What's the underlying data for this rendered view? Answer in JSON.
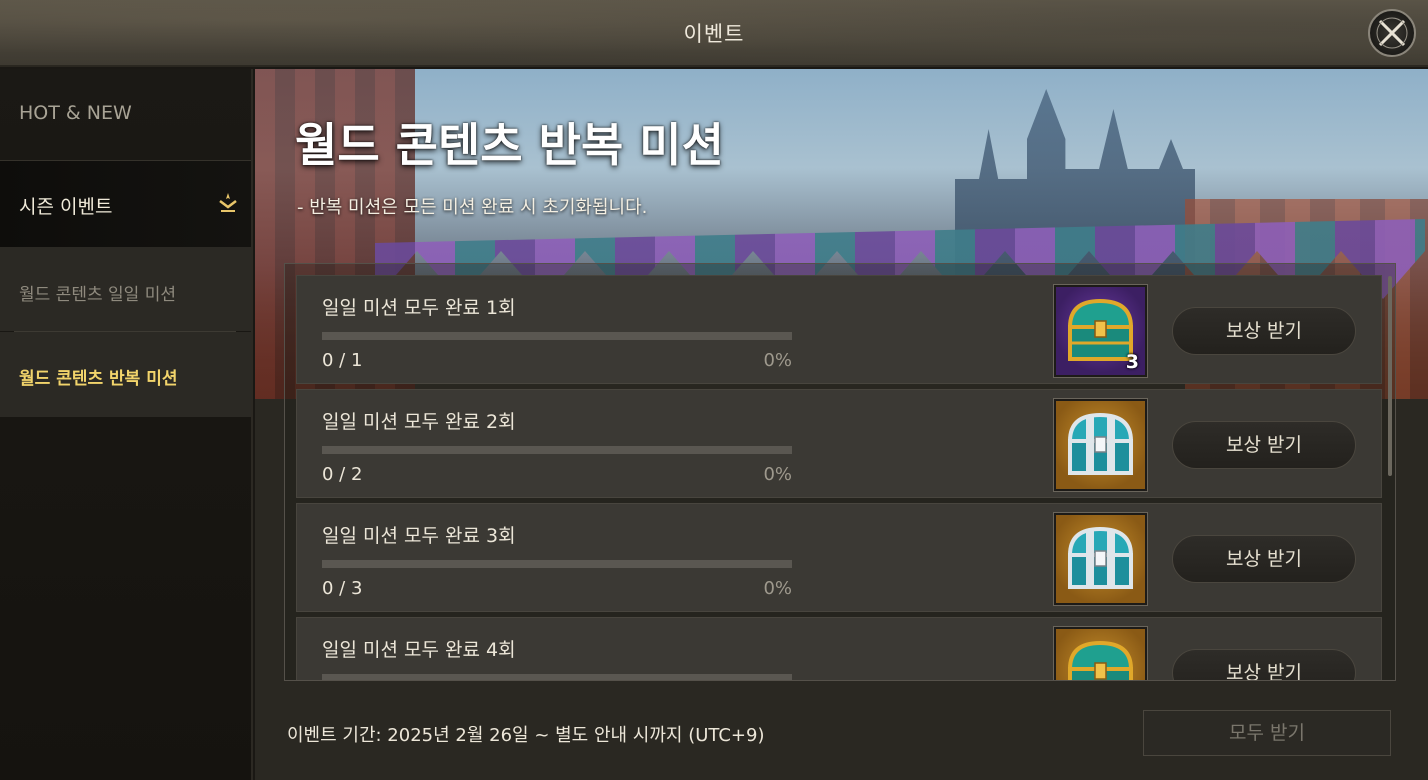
{
  "window": {
    "title": "이벤트"
  },
  "sidebar": {
    "items": [
      {
        "label": "HOT & NEW"
      },
      {
        "label": "시즌 이벤트"
      },
      {
        "label": "월드 콘텐츠 일일 미션"
      },
      {
        "label": "월드 콘텐츠 반복 미션"
      }
    ]
  },
  "banner": {
    "title": "월드 콘텐츠 반복 미션",
    "subtitle": "- 반복 미션은 모든 미션 완료 시 초기화됩니다."
  },
  "missions": [
    {
      "title": "일일 미션 모두 완료 1회",
      "progress": "0 / 1",
      "percent": "0%",
      "progress_fraction": 0,
      "reward_icon": "purple-chest-icon",
      "reward_count": "3",
      "button": "보상 받기"
    },
    {
      "title": "일일 미션 모두 완료 2회",
      "progress": "0 / 2",
      "percent": "0%",
      "progress_fraction": 0,
      "reward_icon": "silver-chest-icon",
      "reward_count": "",
      "button": "보상 받기"
    },
    {
      "title": "일일 미션 모두 완료 3회",
      "progress": "0 / 3",
      "percent": "0%",
      "progress_fraction": 0,
      "reward_icon": "silver-chest-icon",
      "reward_count": "",
      "button": "보상 받기"
    },
    {
      "title": "일일 미션 모두 완료 4회",
      "progress": "",
      "percent": "",
      "progress_fraction": 0,
      "reward_icon": "gold-chest-icon",
      "reward_count": "",
      "button": "보상 받기"
    }
  ],
  "footer": {
    "period": "이벤트 기간: 2025년 2월 26일 ~ 별도 안내 시까지 (UTC+9)",
    "claim_all": "모두 받기"
  },
  "colors": {
    "accent_gold": "#f2d46b",
    "progress_fill": "#c9a54a"
  }
}
